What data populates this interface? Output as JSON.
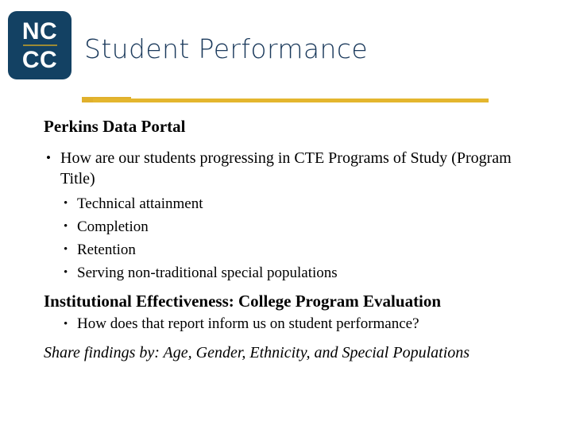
{
  "slide": {
    "title": "Student Performance",
    "brand": {
      "logo_line_1": "NC",
      "logo_line_2": "CC",
      "navy": "#134163",
      "gold": "#e4b62e",
      "logo_rule": "#9c8a35",
      "title_color": "#1b3a5c"
    },
    "content": {
      "heading_1": "Perkins Data Portal",
      "bullet_1": "How are our students progressing in CTE Programs of Study (Program Title)",
      "sub_bullets": [
        "Technical attainment",
        "Completion",
        "Retention",
        "Serving non-traditional special populations"
      ],
      "heading_2": "Institutional Effectiveness: College Program Evaluation",
      "bullet_2": "How does that report inform us on student performance?",
      "closing": "Share findings by:  Age, Gender, Ethnicity, and Special Populations"
    },
    "glyphs": {
      "bullet": "•"
    }
  }
}
